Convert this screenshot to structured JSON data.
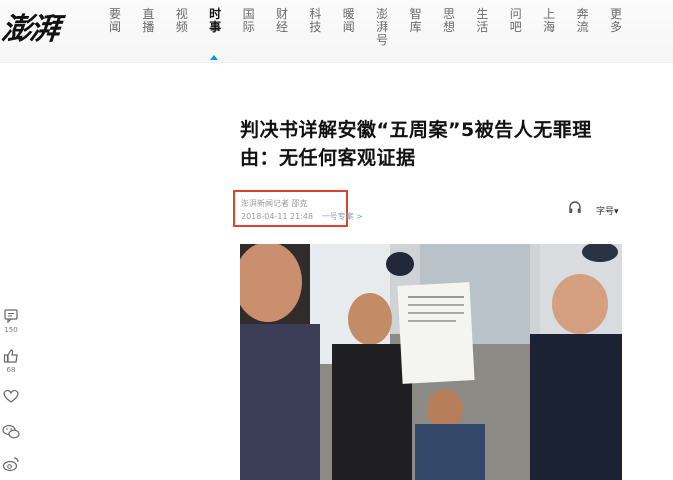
{
  "logo": {
    "text": "澎湃"
  },
  "nav": {
    "items": [
      {
        "label": "要闻",
        "chars": [
          "要",
          "闻"
        ]
      },
      {
        "label": "直播",
        "chars": [
          "直",
          "播"
        ]
      },
      {
        "label": "视频",
        "chars": [
          "视",
          "频"
        ]
      },
      {
        "label": "时事",
        "chars": [
          "时",
          "事"
        ],
        "active": true
      },
      {
        "label": "国际",
        "chars": [
          "国",
          "际"
        ]
      },
      {
        "label": "财经",
        "chars": [
          "财",
          "经"
        ]
      },
      {
        "label": "科技",
        "chars": [
          "科",
          "技"
        ]
      },
      {
        "label": "暖闻",
        "chars": [
          "暖",
          "闻"
        ]
      },
      {
        "label": "澎湃号",
        "chars": [
          "澎",
          "湃",
          "号"
        ]
      },
      {
        "label": "智库",
        "chars": [
          "智",
          "库"
        ]
      },
      {
        "label": "思想",
        "chars": [
          "思",
          "想"
        ]
      },
      {
        "label": "生活",
        "chars": [
          "生",
          "活"
        ]
      },
      {
        "label": "问吧",
        "chars": [
          "问",
          "吧"
        ]
      },
      {
        "label": "上海",
        "chars": [
          "上",
          "海"
        ]
      },
      {
        "label": "奔流",
        "chars": [
          "奔",
          "流"
        ]
      },
      {
        "label": "更多",
        "chars": [
          "更",
          "多"
        ]
      }
    ],
    "accent": "#0096e0"
  },
  "article": {
    "title": "判决书详解安徽“五周案”5被告人无罪理由：无任何客观证据",
    "author": "澎湃新闻记者 邵克",
    "date": "2018-04-11 21:48",
    "follow_link": "一号专案 >",
    "font_size_label": "字号▾",
    "highlight_color": "#e0402e"
  },
  "sidebar": {
    "comments": {
      "icon": "comment-icon",
      "count": "150"
    },
    "likes": {
      "icon": "thumbs-up-icon",
      "count": "68"
    },
    "favorite": {
      "icon": "heart-icon"
    },
    "wechat": {
      "icon": "wechat-icon"
    },
    "weibo": {
      "icon": "weibo-icon"
    }
  }
}
